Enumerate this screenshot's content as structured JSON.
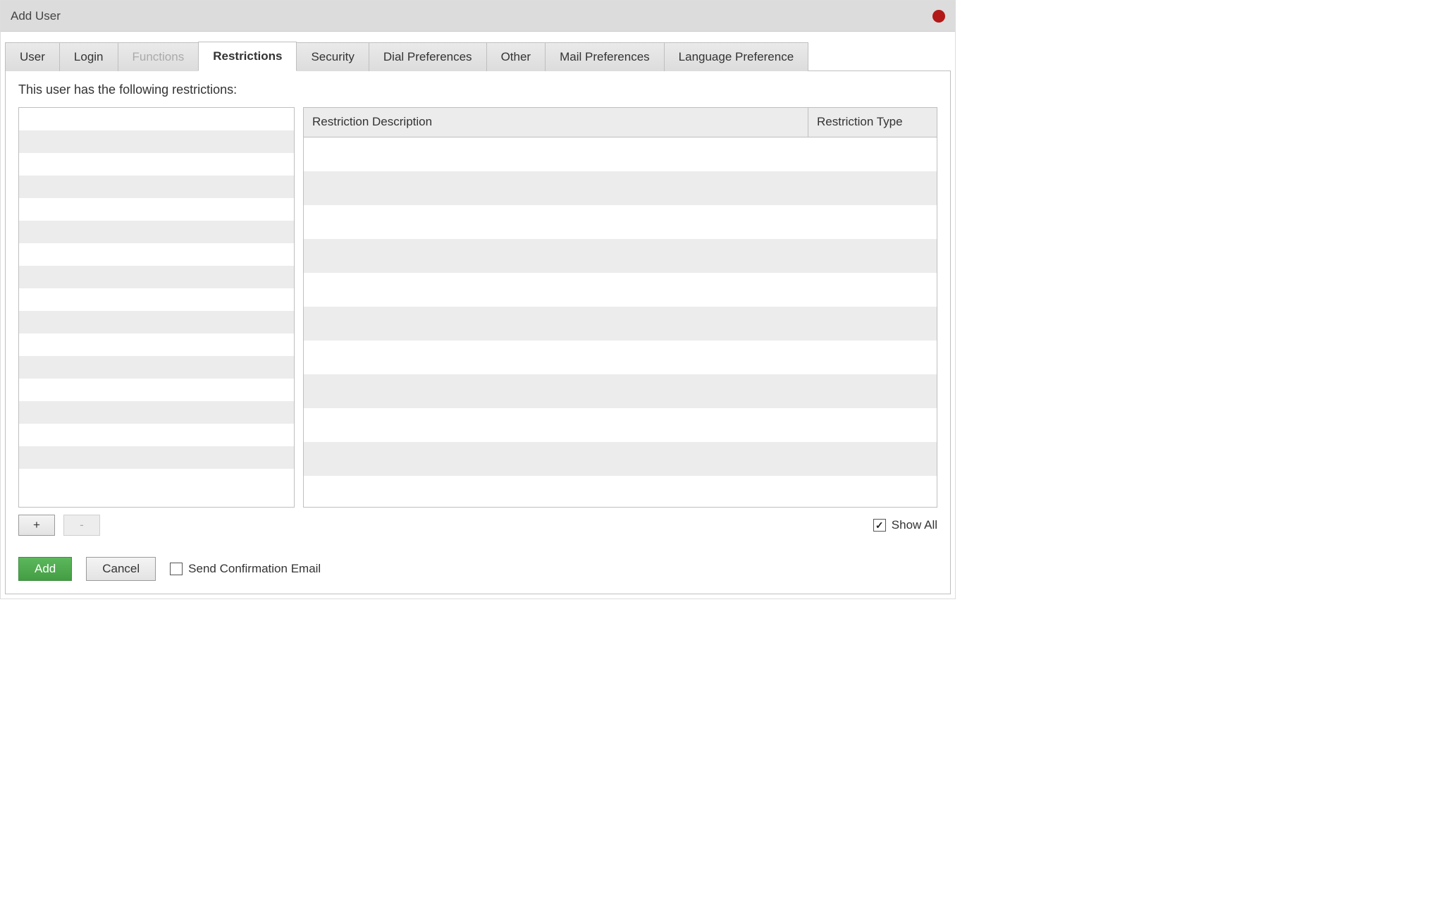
{
  "window": {
    "title": "Add User"
  },
  "tabs": [
    {
      "label": "User",
      "active": false,
      "disabled": false
    },
    {
      "label": "Login",
      "active": false,
      "disabled": false
    },
    {
      "label": "Functions",
      "active": false,
      "disabled": true
    },
    {
      "label": "Restrictions",
      "active": true,
      "disabled": false
    },
    {
      "label": "Security",
      "active": false,
      "disabled": false
    },
    {
      "label": "Dial Preferences",
      "active": false,
      "disabled": false
    },
    {
      "label": "Other",
      "active": false,
      "disabled": false
    },
    {
      "label": "Mail Preferences",
      "active": false,
      "disabled": false
    },
    {
      "label": "Language Preference",
      "active": false,
      "disabled": false
    }
  ],
  "intro_text": "This user has the following restrictions:",
  "left_grid": {
    "rows": 17
  },
  "right_grid": {
    "columns": {
      "description": "Restriction Description",
      "type": "Restriction Type"
    },
    "rows": 11
  },
  "buttons": {
    "plus": "+",
    "minus": "-"
  },
  "show_all": {
    "label": "Show All",
    "checked": true
  },
  "footer": {
    "add": "Add",
    "cancel": "Cancel",
    "send_confirmation": {
      "label": "Send Confirmation Email",
      "checked": false
    }
  }
}
